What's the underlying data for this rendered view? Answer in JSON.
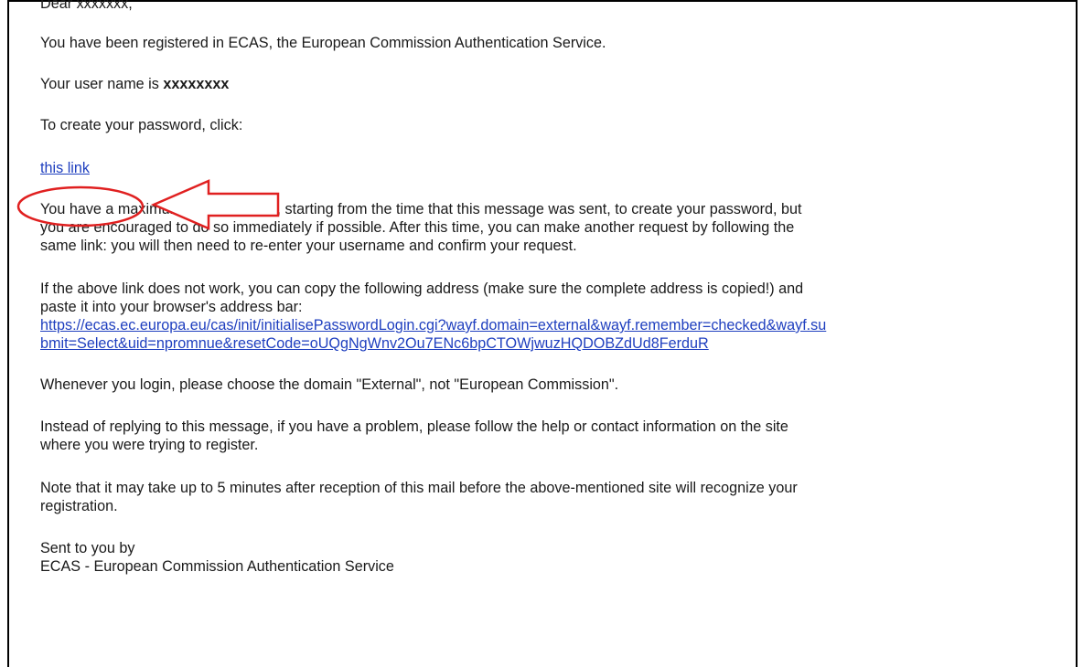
{
  "email": {
    "greeting": "Dear xxxxxxx,",
    "registered_line": "You have been registered in ECAS, the European Commission Authentication Service.",
    "username_prefix": "Your user name is ",
    "username_value": "xxxxxxxx",
    "create_password_line": "To create your password, click:",
    "password_link_label": "this link",
    "expiry_line_1": "You have a maximum of 1 hr 30 min, starting from the time that this message was sent, to create your password, but",
    "expiry_line_2": "you are encouraged to do so immediately if possible. After this time, you can make another request by following the",
    "expiry_line_3": "same link: you will then need to re-enter your username and confirm your request.",
    "fallback_line_1": "If the above link does not work, you can copy the following address (make sure the complete address is copied!) and",
    "fallback_line_2": "paste it into your browser's address bar:",
    "fallback_url_line_1": "https://ecas.ec.europa.eu/cas/init/initialisePasswordLogin.cgi?wayf.domain=external&wayf.remember=checked&wayf.su",
    "fallback_url_line_2": "bmit=Select&uid=npromnue&resetCode=oUQgNgWnv2Ou7ENc6bpCTOWjwuzHQDOBZdUd8FerduR",
    "domain_line": "Whenever you login, please choose the domain \"External\", not \"European Commission\".",
    "help_line_1": "Instead of replying to this message, if you have a problem, please follow the help or contact information on the site",
    "help_line_2": "where you were trying to register.",
    "delay_line_1": "Note that it may take up to 5 minutes after reception of this mail before the above-mentioned site will recognize your",
    "delay_line_2": "registration.",
    "signature_line_1": "Sent to you by",
    "signature_line_2": "ECAS - European Commission Authentication Service"
  },
  "colors": {
    "link": "#1f3fbf",
    "annotation": "#e02020",
    "text": "#1a1a1a"
  }
}
